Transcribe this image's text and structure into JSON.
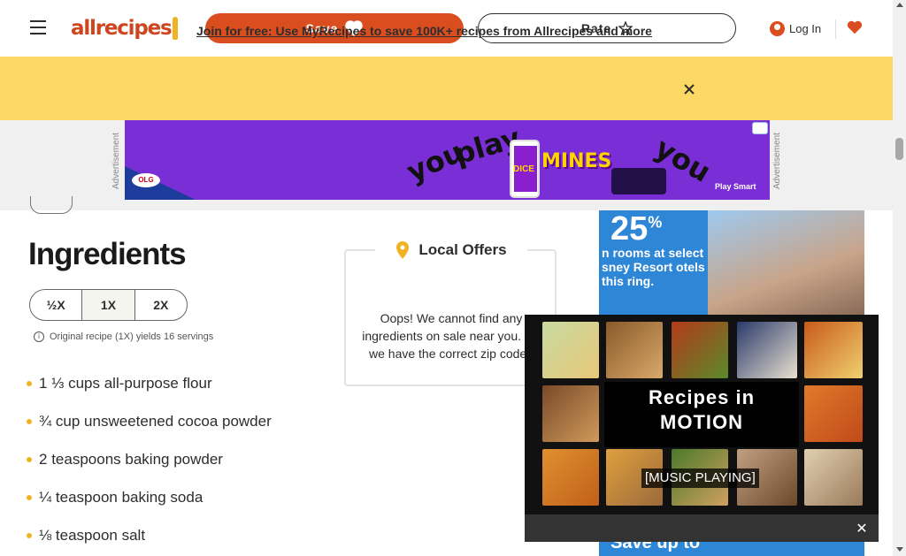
{
  "header": {
    "logo_text": "allrecipes",
    "save_label": "Save",
    "rate_label": "Rate",
    "login_label": "Log In"
  },
  "promo": {
    "link_text": "Join for free: Use MyRecipes to save 100K+ recipes from Allrecipes and more"
  },
  "ad": {
    "label": "Advertisement",
    "words": [
      "you",
      "play",
      "you"
    ],
    "brand": "MINES",
    "sub": "DICE",
    "tagline": "Play Smart",
    "olg": "OLG"
  },
  "ingredients": {
    "title": "Ingredients",
    "scale_options": [
      "½X",
      "1X",
      "2X"
    ],
    "scale_note": "Original recipe (1X) yields 16 servings",
    "items": [
      {
        "qty": "1 ⅓",
        "text": "cups all-purpose flour"
      },
      {
        "qty": "¾",
        "text": "cup unsweetened cocoa powder"
      },
      {
        "qty": "2",
        "text": "teaspoons baking powder"
      },
      {
        "qty": "¼",
        "text": "teaspoon baking soda"
      },
      {
        "qty": "⅛",
        "text": "teaspoon salt"
      }
    ]
  },
  "offers": {
    "title": "Local Offers",
    "message": "Oops! We cannot find any ingredients on sale near you. Do we have the correct zip code?"
  },
  "side_ad": {
    "percent": "25",
    "percent_sign": "%",
    "text": "n rooms at select sney Resort otels this ring.",
    "save_text": "Save up to"
  },
  "video": {
    "title_line1": "Recipes in",
    "title_line2": "MOTION",
    "caption": "[MUSIC PLAYING]",
    "close": "✕"
  },
  "colors": {
    "brand": "#ce4620",
    "save_button": "#d94d1e",
    "promo_bg": "#fcd964",
    "bullet": "#f0b323",
    "ad_purple": "#7a2ed6",
    "side_ad_blue": "#2e86d6"
  }
}
